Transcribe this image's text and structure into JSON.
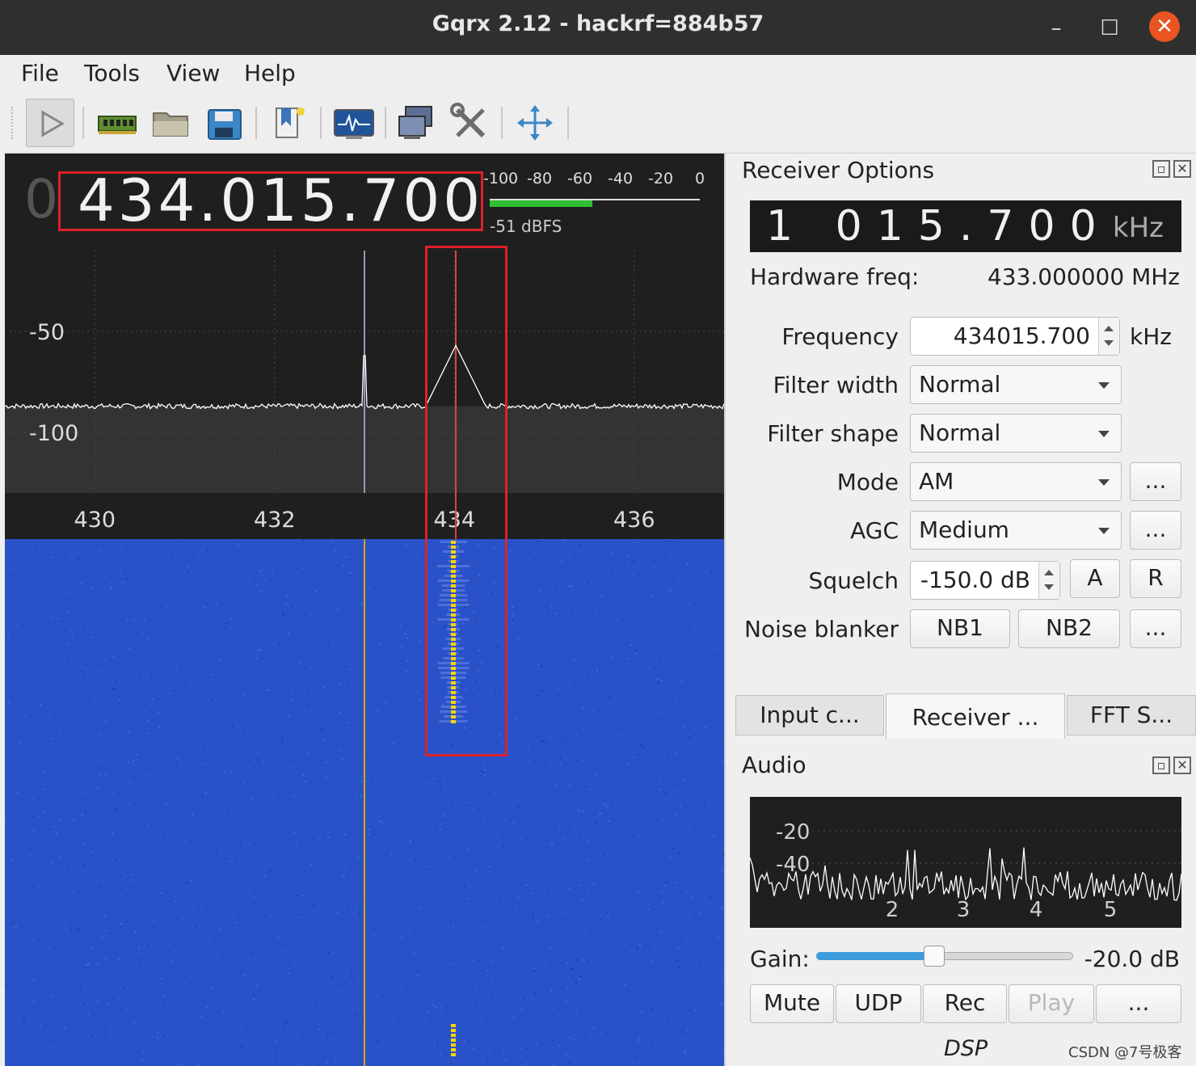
{
  "window": {
    "title": "Gqrx 2.12 - hackrf=884b57",
    "minimize": "–",
    "maximize": "☐",
    "close": "✕"
  },
  "menu": [
    "File",
    "Tools",
    "View",
    "Help"
  ],
  "toolbar": [
    "play-icon",
    "hardware-icon",
    "open-folder-icon",
    "save-icon",
    "bookmark-icon",
    "fft-icon",
    "remote-icon",
    "settings-icon",
    "fullscreen-icon"
  ],
  "frequency_display": {
    "leading_digit": "0",
    "value": "434.015.700"
  },
  "signal_meter": {
    "scale": [
      "-100",
      "-80",
      "-60",
      "-40",
      "-20",
      "0"
    ],
    "level_label": "-51 dBFS",
    "level_fraction": 0.49
  },
  "spectrum": {
    "y_labels": [
      "-50",
      "-100"
    ],
    "x_labels": [
      "430",
      "432",
      "434",
      "436"
    ],
    "x_range": [
      429.0,
      437.0
    ],
    "y_range": [
      -130,
      -10
    ],
    "hardware_marker_mhz": 433.0,
    "receiver_marker_mhz": 434.0157,
    "noise_floor_db": -87,
    "colors": {
      "background": "#1f1f1f",
      "trace": "#ffffff",
      "waterfall": "#2a52c8",
      "signal": "#ffd400",
      "center_line": "#e0a100"
    }
  },
  "receiver": {
    "title": "Receiver Options",
    "lcd_value": "1 015.700",
    "lcd_unit": "kHz",
    "hardware_freq_label": "Hardware freq:",
    "hardware_freq_value": "433.000000 MHz",
    "frequency_label": "Frequency",
    "frequency_value": "434015.700",
    "frequency_unit": "kHz",
    "filter_width_label": "Filter width",
    "filter_width_value": "Normal",
    "filter_shape_label": "Filter shape",
    "filter_shape_value": "Normal",
    "mode_label": "Mode",
    "mode_value": "AM",
    "agc_label": "AGC",
    "agc_value": "Medium",
    "squelch_label": "Squelch",
    "squelch_value": "-150.0 dB",
    "squelch_a": "A",
    "squelch_r": "R",
    "noise_blanker_label": "Noise blanker",
    "nb1": "NB1",
    "nb2": "NB2",
    "more": "..."
  },
  "tabs": [
    "Input c...",
    "Receiver ...",
    "FFT S..."
  ],
  "audio": {
    "title": "Audio",
    "y_labels": [
      "-20",
      "-40"
    ],
    "x_labels": [
      "2",
      "3",
      "4",
      "5"
    ],
    "gain_label": "Gain:",
    "gain_value": "-20.0 dB",
    "gain_fraction": 0.46,
    "buttons": [
      "Mute",
      "UDP",
      "Rec",
      "Play",
      "..."
    ]
  },
  "dsp_label": "DSP",
  "watermark": "CSDN @7号极客"
}
